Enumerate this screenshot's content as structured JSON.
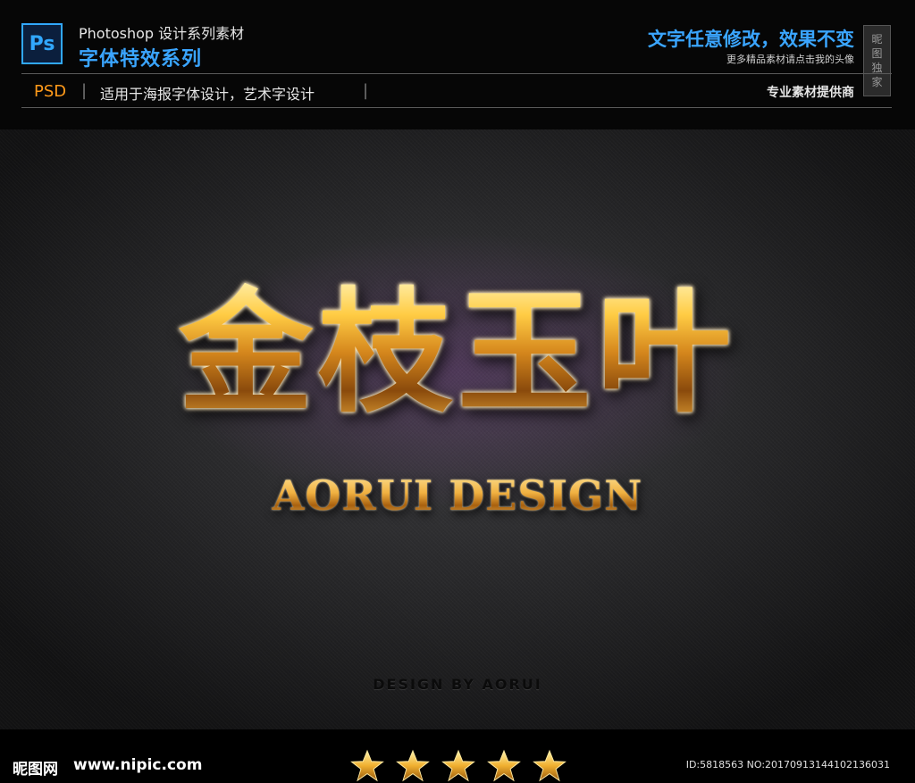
{
  "header": {
    "ps_logo": "Ps",
    "top_title": "Photoshop 设计系列素材",
    "series": "字体特效系列",
    "right_title": "文字任意修改，效果不变",
    "right_sub": "更多精品素材请点击我的头像",
    "stamp_chars": [
      "昵",
      "图",
      "独",
      "家"
    ],
    "psd": "PSD",
    "separator": "|",
    "usage": "适用于海报字体设计，艺术字设计",
    "provider": "专业素材提供商"
  },
  "artwork": {
    "main_title": "金枝玉叶",
    "sub_title": "AORUI DESIGN",
    "credit": "DESIGN BY AORUI"
  },
  "footer": {
    "logo": "昵图网",
    "url": "www.nipic.com",
    "star_count": 5,
    "ids": "ID:5818563 NO:20170913144102136031"
  },
  "colors": {
    "accent_blue": "#3aa5ff",
    "psd_orange": "#ff9a1a",
    "gold": "#f0a830"
  }
}
